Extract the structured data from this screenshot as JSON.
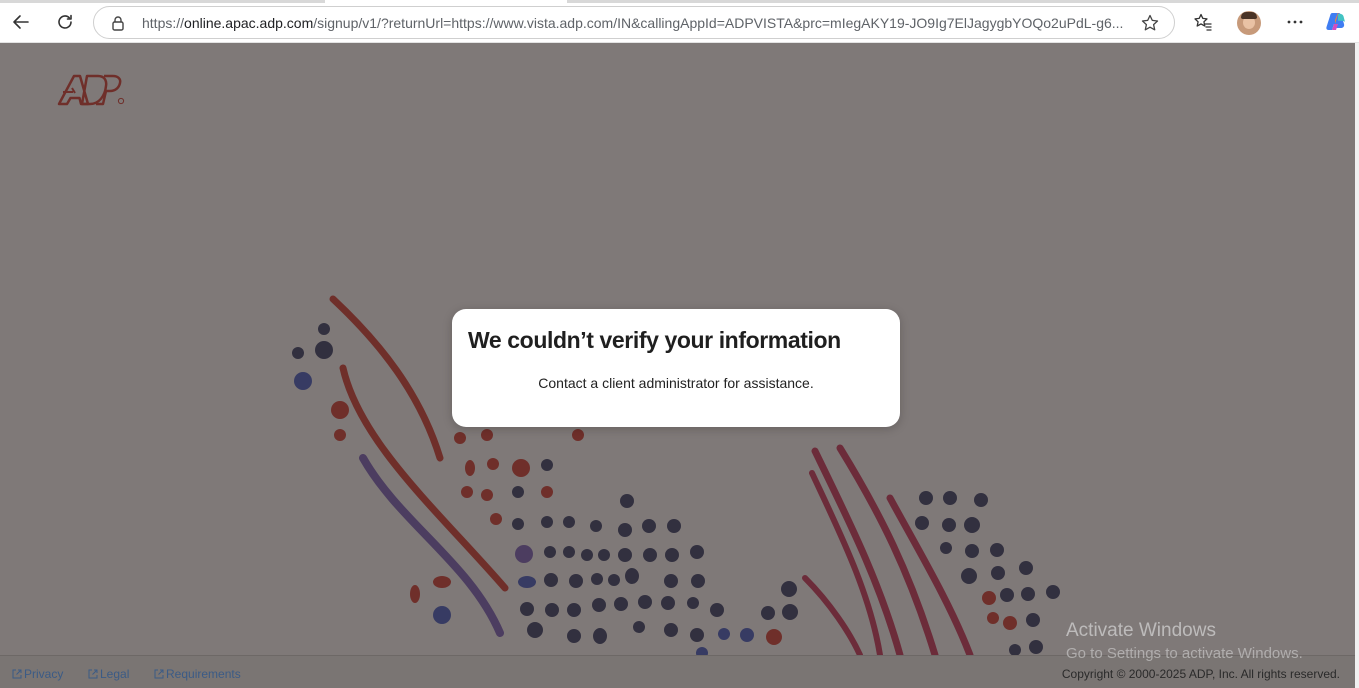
{
  "browser": {
    "url_host": "online.apac.adp.com",
    "url_path": "/signup/v1/?returnUrl=https://www.vista.adp.com/IN&callingAppId=ADPVISTA&prc=mIegAKY19-JO9Ig7ElJagygbYOQo2uPdL-g6...",
    "url_scheme": "https://",
    "icons": [
      "back-arrow-icon",
      "refresh-icon",
      "lock-icon",
      "star-icon",
      "favorites-icon",
      "avatar",
      "more-icon",
      "copilot-icon"
    ]
  },
  "logo": {
    "text": "ADP",
    "color": "#d0271d"
  },
  "modal": {
    "title": "We couldn’t verify your information",
    "message": "Contact a client administrator for assistance."
  },
  "footer": {
    "links": [
      "Privacy",
      "Legal",
      "Requirements"
    ],
    "copyright": "Copyright © 2000-2025 ADP, Inc. All rights reserved."
  },
  "watermark": {
    "line1": "Activate Windows",
    "line2": "Go to Settings to activate Windows."
  },
  "colors": {
    "overlay": "#7b7673",
    "accent_red": "#d0271d",
    "dot_navy": "#1f2a5a",
    "dot_purple": "#5b4aa0"
  }
}
